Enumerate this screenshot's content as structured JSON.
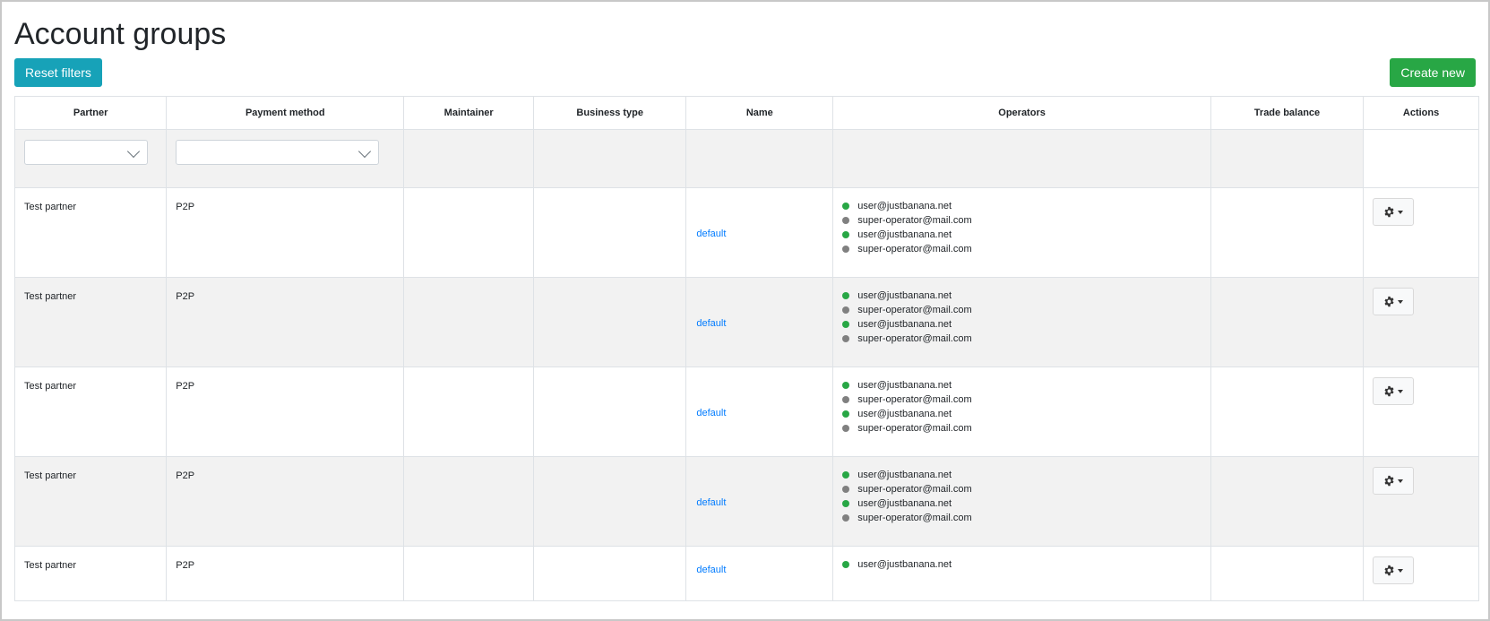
{
  "page": {
    "title": "Account groups",
    "reset_filters_label": "Reset filters",
    "create_new_label": "Create new"
  },
  "table": {
    "headers": [
      "Partner",
      "Payment method",
      "Maintainer",
      "Business type",
      "Name",
      "Operators",
      "Trade balance",
      "Actions"
    ],
    "filters": {
      "partner_value": "",
      "payment_method_value": ""
    },
    "rows": [
      {
        "partner": "Test partner",
        "payment_method": "P2P",
        "maintainer": "",
        "business_type": "",
        "name": "default",
        "operators": [
          {
            "email": "user@justbanana.net",
            "status": "green"
          },
          {
            "email": "super-operator@mail.com",
            "status": "gray"
          },
          {
            "email": "user@justbanana.net",
            "status": "green"
          },
          {
            "email": "super-operator@mail.com",
            "status": "gray"
          }
        ],
        "trade_balance": ""
      },
      {
        "partner": "Test partner",
        "payment_method": "P2P",
        "maintainer": "",
        "business_type": "",
        "name": "default",
        "operators": [
          {
            "email": "user@justbanana.net",
            "status": "green"
          },
          {
            "email": "super-operator@mail.com",
            "status": "gray"
          },
          {
            "email": "user@justbanana.net",
            "status": "green"
          },
          {
            "email": "super-operator@mail.com",
            "status": "gray"
          }
        ],
        "trade_balance": ""
      },
      {
        "partner": "Test partner",
        "payment_method": "P2P",
        "maintainer": "",
        "business_type": "",
        "name": "default",
        "operators": [
          {
            "email": "user@justbanana.net",
            "status": "green"
          },
          {
            "email": "super-operator@mail.com",
            "status": "gray"
          },
          {
            "email": "user@justbanana.net",
            "status": "green"
          },
          {
            "email": "super-operator@mail.com",
            "status": "gray"
          }
        ],
        "trade_balance": ""
      },
      {
        "partner": "Test partner",
        "payment_method": "P2P",
        "maintainer": "",
        "business_type": "",
        "name": "default",
        "operators": [
          {
            "email": "user@justbanana.net",
            "status": "green"
          },
          {
            "email": "super-operator@mail.com",
            "status": "gray"
          },
          {
            "email": "user@justbanana.net",
            "status": "green"
          },
          {
            "email": "super-operator@mail.com",
            "status": "gray"
          }
        ],
        "trade_balance": ""
      },
      {
        "partner": "Test partner",
        "payment_method": "P2P",
        "maintainer": "",
        "business_type": "",
        "name": "default",
        "operators": [
          {
            "email": "user@justbanana.net",
            "status": "green"
          }
        ],
        "trade_balance": ""
      }
    ]
  },
  "icons": {
    "actions": "gear-icon",
    "actions_dropdown": "caret-down-icon",
    "select_arrow": "chevron-down-icon"
  },
  "colors": {
    "reset_button": "#17a2b8",
    "create_button": "#28a745",
    "status_online": "#28a745",
    "status_offline": "#808080",
    "link": "#007bff"
  }
}
